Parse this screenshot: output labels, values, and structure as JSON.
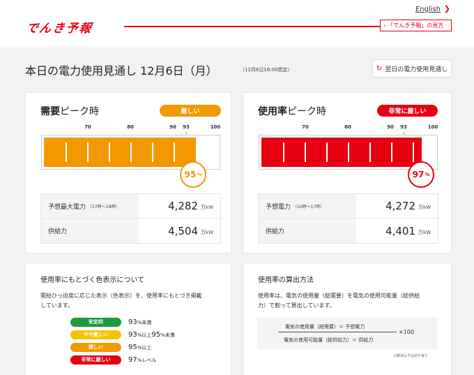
{
  "header": {
    "logo": "でんき予報",
    "english_link": "English",
    "guide_link": "「でんき予報」の見方"
  },
  "title": {
    "main": "本日の電力使用見通し 12月6日（月）",
    "sub": "（12月6日16:00想定）",
    "tomorrow_button": "翌日の電力使用見通し"
  },
  "demand_peak": {
    "title_bold": "需要",
    "title_rest": "ピーク時",
    "status": "厳しい",
    "status_color": "#f39800",
    "percent": 95,
    "percent_unit": "%",
    "ticks": [
      "70",
      "80",
      "90",
      "93",
      "100"
    ],
    "rows": [
      {
        "label": "予想最大電力",
        "note": "（17時〜18時）",
        "value": "4,282",
        "unit": "万kW"
      },
      {
        "label": "供給力",
        "note": "",
        "value": "4,504",
        "unit": "万kW"
      }
    ]
  },
  "usage_peak": {
    "title_bold": "使用率",
    "title_rest": "ピーク時",
    "status": "非常に厳しい",
    "status_color": "#e60012",
    "percent": 97,
    "percent_unit": "%",
    "ticks": [
      "70",
      "80",
      "90",
      "93",
      "100"
    ],
    "rows": [
      {
        "label": "予想電力",
        "note": "（16時〜17時）",
        "value": "4,272",
        "unit": "万kW"
      },
      {
        "label": "供給力",
        "note": "",
        "value": "4,401",
        "unit": "万kW"
      }
    ]
  },
  "color_legend": {
    "title": "使用率にもとづく色表示について",
    "text_line1": "需給ひっ迫度に応じた表示（色表示）を、使用率にもとづき掲載",
    "text_line2": "しています。",
    "items": [
      {
        "label": "安定的",
        "color": "#1d9a3e",
        "value": "93",
        "desc": "%未満",
        "value2": "",
        "desc2": ""
      },
      {
        "label": "やや厳しい",
        "color": "#f5c400",
        "value": "93",
        "desc": "%以上",
        "value2": "95",
        "desc2": "%未満"
      },
      {
        "label": "厳しい",
        "color": "#f39800",
        "value": "95",
        "desc": "%以上",
        "value2": "",
        "desc2": ""
      },
      {
        "label": "非常に厳しい",
        "color": "#e60012",
        "value": "97",
        "desc": "%レベル",
        "value2": "",
        "desc2": ""
      }
    ]
  },
  "calc_method": {
    "title": "使用率の算出方法",
    "text_line1": "使用率は、電気の使用量（総需要）を電気の使用可能量（総供給",
    "text_line2": "力）で割って算出しています。",
    "numerator": "電気の使用量（総需要）＝ 予想電力",
    "denominator": "電気の使用可能量（総供給力）＝ 供給力",
    "multiplier": "×100",
    "note": "小数点以下は切り捨て"
  }
}
